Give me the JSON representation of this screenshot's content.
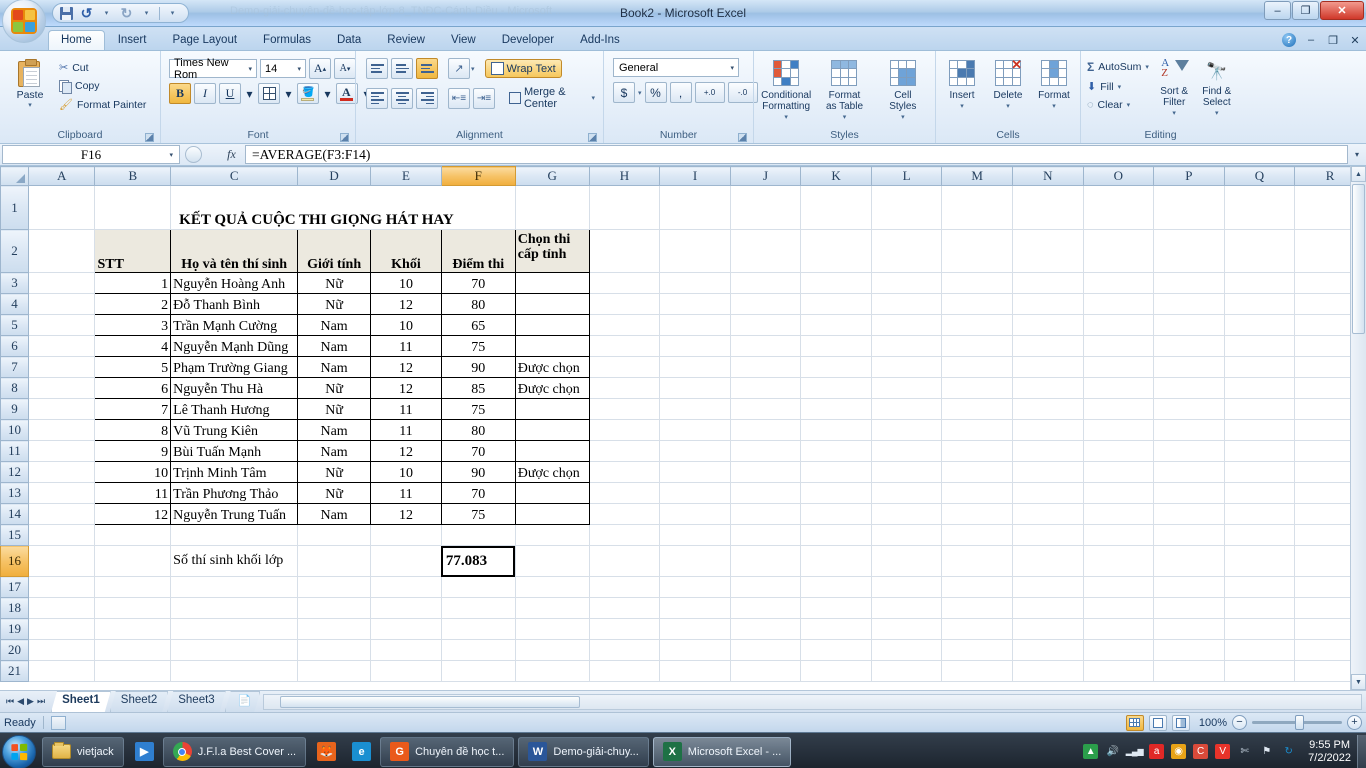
{
  "window": {
    "title": "Book2 - Microsoft Excel",
    "ghost_title": "Demo-giải-chuyên-đề-học-tập-lớp-8_TNĐC-Cánh-Diều - Microsoft ...",
    "minimize": "–",
    "restore": "❐",
    "close": "✕"
  },
  "qat": {
    "save": "save-icon",
    "undo": "↺",
    "undo_arrow": "▾",
    "redo": "↻",
    "redo_arrow": "▾",
    "customize": "▾"
  },
  "ribbon_help": {
    "help": "?",
    "minimize": "–",
    "restore": "❐",
    "close": "✕"
  },
  "tabs": [
    {
      "label": "Home",
      "active": true
    },
    {
      "label": "Insert",
      "active": false
    },
    {
      "label": "Page Layout",
      "active": false
    },
    {
      "label": "Formulas",
      "active": false
    },
    {
      "label": "Data",
      "active": false
    },
    {
      "label": "Review",
      "active": false
    },
    {
      "label": "View",
      "active": false
    },
    {
      "label": "Developer",
      "active": false
    },
    {
      "label": "Add-Ins",
      "active": false
    }
  ],
  "ribbon": {
    "clipboard": {
      "label": "Clipboard",
      "paste": "Paste",
      "paste_arrow": "▾",
      "cut": "Cut",
      "copy": "Copy",
      "format_painter": "Format Painter"
    },
    "font": {
      "label": "Font",
      "font_name": "Times New Rom",
      "font_size": "14",
      "grow_font": "A",
      "shrink_font": "A",
      "bold": "B",
      "italic": "I",
      "underline": "U",
      "borders": "▦",
      "fill_color": "A",
      "font_color": "A"
    },
    "alignment": {
      "label": "Alignment",
      "top_align": "top-align-icon",
      "middle_align": "middle-align-icon",
      "bottom_align": "bottom-align-icon",
      "orientation": "orientation-icon",
      "align_left": "align-left-icon",
      "align_center": "align-center-icon",
      "align_right": "align-right-icon",
      "decrease_indent": "decrease-indent-icon",
      "increase_indent": "increase-indent-icon",
      "wrap_text": "Wrap Text",
      "merge_center": "Merge & Center"
    },
    "number": {
      "label": "Number",
      "format": "General",
      "currency": "$",
      "percent": "%",
      "comma": ",",
      "increase_decimal": "+.0",
      "decrease_decimal": "-.0"
    },
    "styles": {
      "label": "Styles",
      "conditional_formatting": "Conditional\nFormatting",
      "conditional_formatting_l1": "Conditional",
      "conditional_formatting_l2": "Formatting",
      "format_as_table_l1": "Format",
      "format_as_table_l2": "as Table",
      "cell_styles_l1": "Cell",
      "cell_styles_l2": "Styles"
    },
    "cells": {
      "label": "Cells",
      "insert": "Insert",
      "delete": "Delete",
      "format": "Format"
    },
    "editing": {
      "label": "Editing",
      "autosum": "AutoSum",
      "autosum_sigma": "Σ",
      "fill": "Fill",
      "clear": "Clear",
      "sort_filter_l1": "Sort &",
      "sort_filter_l2": "Filter",
      "find_select_l1": "Find &",
      "find_select_l2": "Select"
    }
  },
  "formula_bar": {
    "name_box": "F16",
    "cancel": "✕",
    "enter": "✓",
    "fx": "fx",
    "formula": "=AVERAGE(F3:F14)",
    "expand": "▾"
  },
  "grid": {
    "columns": [
      "A",
      "B",
      "C",
      "D",
      "E",
      "F",
      "G",
      "H",
      "I",
      "J",
      "K",
      "L",
      "M",
      "N",
      "O",
      "P",
      "Q",
      "R"
    ],
    "selected_column": "F",
    "selected_row": "16",
    "rows": [
      "1",
      "2",
      "3",
      "4",
      "5",
      "6",
      "7",
      "8",
      "9",
      "10",
      "11",
      "12",
      "13",
      "14",
      "15",
      "16",
      "17",
      "18",
      "19",
      "20",
      "21"
    ],
    "title_cell": "KẾT QUẢ CUỘC THI GIỌNG HÁT HAY",
    "headers": [
      "STT",
      "Họ và tên thí sinh",
      "Giới tính",
      "Khối",
      "Điểm thi",
      "Chọn thi cấp tỉnh"
    ],
    "header_chon_l1": "Chọn thi",
    "header_chon_l2": "cấp tỉnh",
    "data": [
      {
        "stt": "1",
        "name": "Nguyễn Hoàng Anh",
        "gender": "Nữ",
        "khoi": "10",
        "diem": "70",
        "chon": ""
      },
      {
        "stt": "2",
        "name": "Đỗ Thanh Bình",
        "gender": "Nữ",
        "khoi": "12",
        "diem": "80",
        "chon": ""
      },
      {
        "stt": "3",
        "name": "Trần Mạnh Cường",
        "gender": "Nam",
        "khoi": "10",
        "diem": "65",
        "chon": ""
      },
      {
        "stt": "4",
        "name": "Nguyễn Mạnh Dũng",
        "gender": "Nam",
        "khoi": "11",
        "diem": "75",
        "chon": ""
      },
      {
        "stt": "5",
        "name": "Phạm Trường Giang",
        "gender": "Nam",
        "khoi": "12",
        "diem": "90",
        "chon": "Được chọn"
      },
      {
        "stt": "6",
        "name": "Nguyễn Thu Hà",
        "gender": "Nữ",
        "khoi": "12",
        "diem": "85",
        "chon": "Được chọn"
      },
      {
        "stt": "7",
        "name": "Lê Thanh Hương",
        "gender": "Nữ",
        "khoi": "11",
        "diem": "75",
        "chon": ""
      },
      {
        "stt": "8",
        "name": "Vũ Trung Kiên",
        "gender": "Nam",
        "khoi": "11",
        "diem": "80",
        "chon": ""
      },
      {
        "stt": "9",
        "name": "Bùi Tuấn Mạnh",
        "gender": "Nam",
        "khoi": "12",
        "diem": "70",
        "chon": ""
      },
      {
        "stt": "10",
        "name": "Trịnh Minh Tâm",
        "gender": "Nữ",
        "khoi": "10",
        "diem": "90",
        "chon": "Được chọn"
      },
      {
        "stt": "11",
        "name": "Trần Phương Thảo",
        "gender": "Nữ",
        "khoi": "11",
        "diem": "70",
        "chon": ""
      },
      {
        "stt": "12",
        "name": "Nguyễn Trung Tuấn",
        "gender": "Nam",
        "khoi": "12",
        "diem": "75",
        "chon": ""
      }
    ],
    "summary_label": "Số thí sinh khối lớp",
    "summary_value": "77.083"
  },
  "sheet_tabs": {
    "first": "⏮",
    "prev": "◀",
    "next": "▶",
    "last": "⏭",
    "tabs": [
      {
        "label": "Sheet1",
        "active": true
      },
      {
        "label": "Sheet2",
        "active": false
      },
      {
        "label": "Sheet3",
        "active": false
      }
    ],
    "insert_sheet": "insert-worksheet-icon"
  },
  "status_bar": {
    "state": "Ready",
    "macro_icon": "record-macro-icon",
    "view_normal": "normal-view-icon",
    "view_layout": "page-layout-view-icon",
    "view_break": "page-break-view-icon",
    "zoom": "100%",
    "zoom_out": "−",
    "zoom_in": "+"
  },
  "taskbar": {
    "start": "start-button",
    "items": [
      {
        "label": "vietjack",
        "icon": "folder-icon",
        "active": false,
        "plain": false
      },
      {
        "label": "",
        "icon": "media-player-icon",
        "active": false,
        "plain": true
      },
      {
        "label": "J.F.l.a Best Cover ...",
        "icon": "chrome-icon",
        "active": false,
        "plain": false
      },
      {
        "label": "",
        "icon": "firefox-icon",
        "active": false,
        "plain": true
      },
      {
        "label": "",
        "icon": "internet-explorer-icon",
        "active": false,
        "plain": true
      },
      {
        "label": "Chuyên đề học t...",
        "icon": "pdf-icon",
        "active": false,
        "plain": false
      },
      {
        "label": "Demo-giải-chuy...",
        "icon": "word-icon",
        "active": false,
        "plain": false
      },
      {
        "label": "Microsoft Excel - ...",
        "icon": "excel-icon",
        "active": true,
        "plain": false
      }
    ],
    "tray": [
      {
        "name": "google-drive-icon",
        "glyph": "▲",
        "color": "#2b9e4b"
      },
      {
        "name": "volume-icon",
        "glyph": "🔊",
        "color": "#dfe8f2"
      },
      {
        "name": "network-icon",
        "glyph": "▂▄▆",
        "color": "#dfe8f2"
      },
      {
        "name": "avira-icon",
        "glyph": "a",
        "color": "#e02826"
      },
      {
        "name": "idm-icon",
        "glyph": "◉",
        "color": "#e8a317"
      },
      {
        "name": "ccleaner-icon",
        "glyph": "C",
        "color": "#d94a3a"
      },
      {
        "name": "vnpt-icon",
        "glyph": "V",
        "color": "#e8332a"
      },
      {
        "name": "unikey-icon",
        "glyph": "✄",
        "color": "#c9d6e2"
      },
      {
        "name": "action-center-icon",
        "glyph": "⚑",
        "color": "#dfe8f2"
      },
      {
        "name": "teamviewer-icon",
        "glyph": "↻",
        "color": "#1a8fd1"
      }
    ],
    "time": "9:55 PM",
    "date": "7/2/2022"
  }
}
